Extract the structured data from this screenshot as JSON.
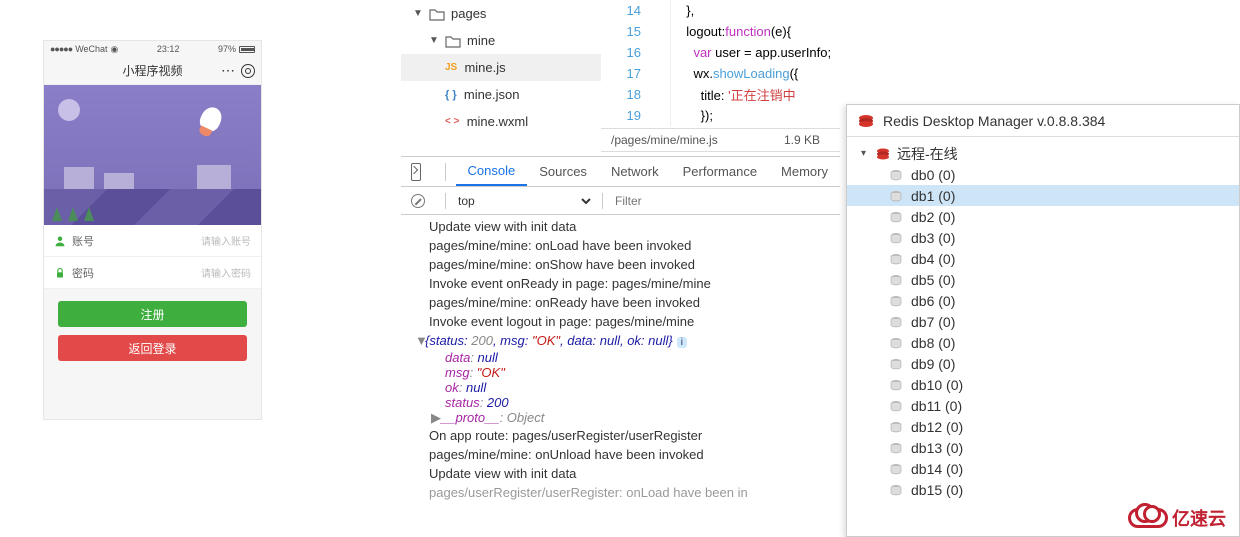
{
  "phone": {
    "carrier": "WeChat",
    "signal": "●●●●●",
    "time": "23:12",
    "battery": "97%",
    "title": "小程序视频",
    "account_label": "账号",
    "account_ph": "请输入账号",
    "password_label": "密码",
    "password_ph": "请输入密码",
    "register": "注册",
    "back_login": "返回登录"
  },
  "tree": {
    "pages": "pages",
    "mine": "mine",
    "minejs": "mine.js",
    "minejson": "mine.json",
    "minewxml": "mine.wxml"
  },
  "code": {
    "l14": {
      "n": "14",
      "t": "  },"
    },
    "l15": {
      "n": "15",
      "t": "  logout:",
      "fn": "function",
      "t2": "(e){"
    },
    "l16": {
      "n": "16",
      "t": "    ",
      "kw": "var",
      "t2": " user = app.userInfo;"
    },
    "l17": {
      "n": "17",
      "t": "    wx.",
      "fn": "showLoading",
      "t2": "({"
    },
    "l18": {
      "n": "18",
      "t": "      title: ",
      "s": "'正在注销中"
    },
    "l19": {
      "n": "19",
      "t": "      });"
    }
  },
  "crumb": {
    "path": "/pages/mine/mine.js",
    "size": "1.9 KB"
  },
  "dt": {
    "tabs": [
      "Console",
      "Sources",
      "Network",
      "Performance",
      "Memory"
    ],
    "context": "top",
    "filter_ph": "Filter",
    "logs": [
      "Update view with init data",
      "pages/mine/mine: onLoad have been invoked",
      "pages/mine/mine: onShow have been invoked",
      "Invoke event onReady in page: pages/mine/mine",
      "pages/mine/mine: onReady have been invoked",
      "Invoke event logout in page: pages/mine/mine"
    ],
    "obj": "{status: 200, msg: \"OK\", data: null, ok: null}",
    "obj_badge": "i",
    "exp": [
      {
        "k": "data",
        "v": "null",
        "t": "n"
      },
      {
        "k": "msg",
        "v": "\"OK\"",
        "t": "s"
      },
      {
        "k": "ok",
        "v": "null",
        "t": "n"
      },
      {
        "k": "status",
        "v": "200",
        "t": "n"
      },
      {
        "k": "__proto__",
        "v": "Object",
        "t": "o"
      }
    ],
    "logs2": [
      "On app route: pages/userRegister/userRegister",
      "pages/mine/mine: onUnload have been invoked",
      "Update view with init data",
      "pages/userRegister/userRegister: onLoad have been in"
    ]
  },
  "redis": {
    "title": "Redis Desktop Manager v.0.8.8.384",
    "server": "远程-在线",
    "dbs": [
      "db0 (0)",
      "db1 (0)",
      "db2 (0)",
      "db3 (0)",
      "db4 (0)",
      "db5 (0)",
      "db6 (0)",
      "db7 (0)",
      "db8 (0)",
      "db9 (0)",
      "db10 (0)",
      "db11 (0)",
      "db12 (0)",
      "db13 (0)",
      "db14 (0)",
      "db15 (0)"
    ],
    "selected": 1
  },
  "watermark": "亿速云"
}
